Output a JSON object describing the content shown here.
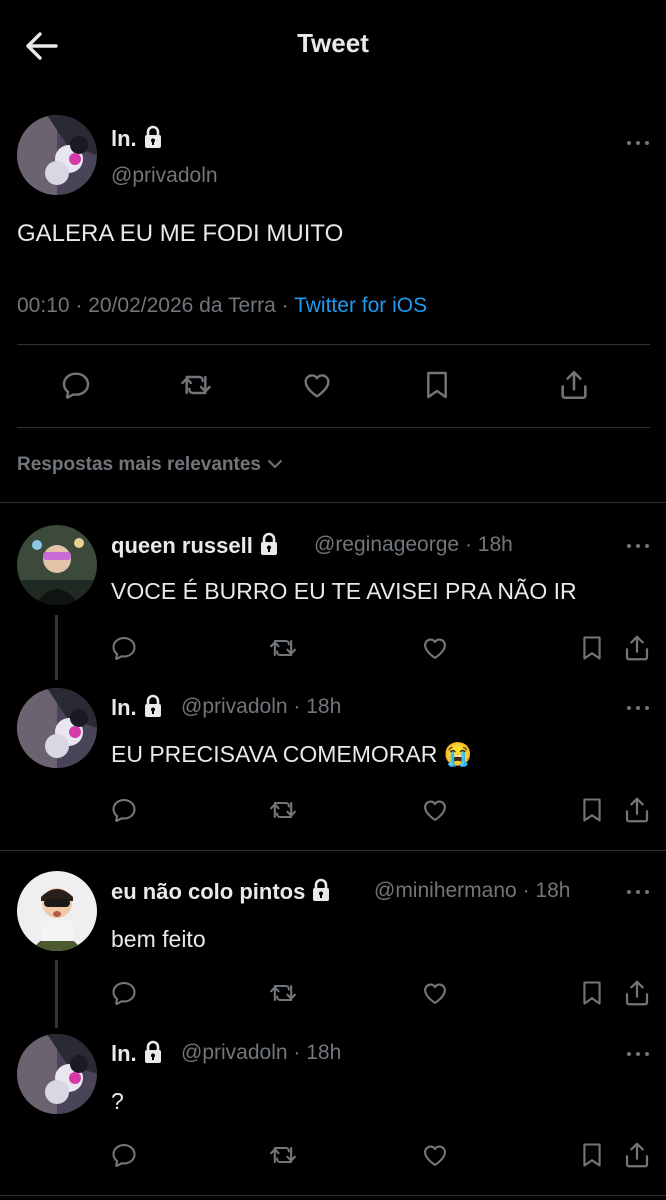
{
  "header": {
    "title": "Tweet"
  },
  "main_tweet": {
    "author_name": "ln.",
    "author_handle": "@privadoln",
    "text": "GALERA EU ME FODI MUITO",
    "time_date": "00:10 · 20/02/2026 da Terra · ",
    "source": "Twitter for iOS"
  },
  "sort_label": "Respostas mais relevantes",
  "replies": [
    {
      "name": "queen russell",
      "handle": "@reginageorge",
      "time": "· 18h",
      "text": "VOCE É BURRO EU TE AVISEI PRA NÃO IR"
    },
    {
      "name": "ln.",
      "handle": "@privadoln",
      "time": "· 18h",
      "text": "EU PRECISAVA COMEMORAR 😭"
    },
    {
      "name": "eu não colo pintos",
      "handle": "@minihermano",
      "time": "· 18h",
      "text": "bem feito"
    },
    {
      "name": "ln.",
      "handle": "@privadoln",
      "time": "· 18h",
      "text": "?"
    }
  ],
  "colors": {
    "background": "#000000",
    "text": "#e7e9ea",
    "muted": "#71767b",
    "link": "#1d9bf0",
    "divider": "#2f3336"
  },
  "icons": [
    "back-arrow-icon",
    "lock-icon",
    "more-icon",
    "reply-icon",
    "retweet-icon",
    "like-icon",
    "bookmark-icon",
    "share-icon",
    "chevron-down-icon"
  ]
}
